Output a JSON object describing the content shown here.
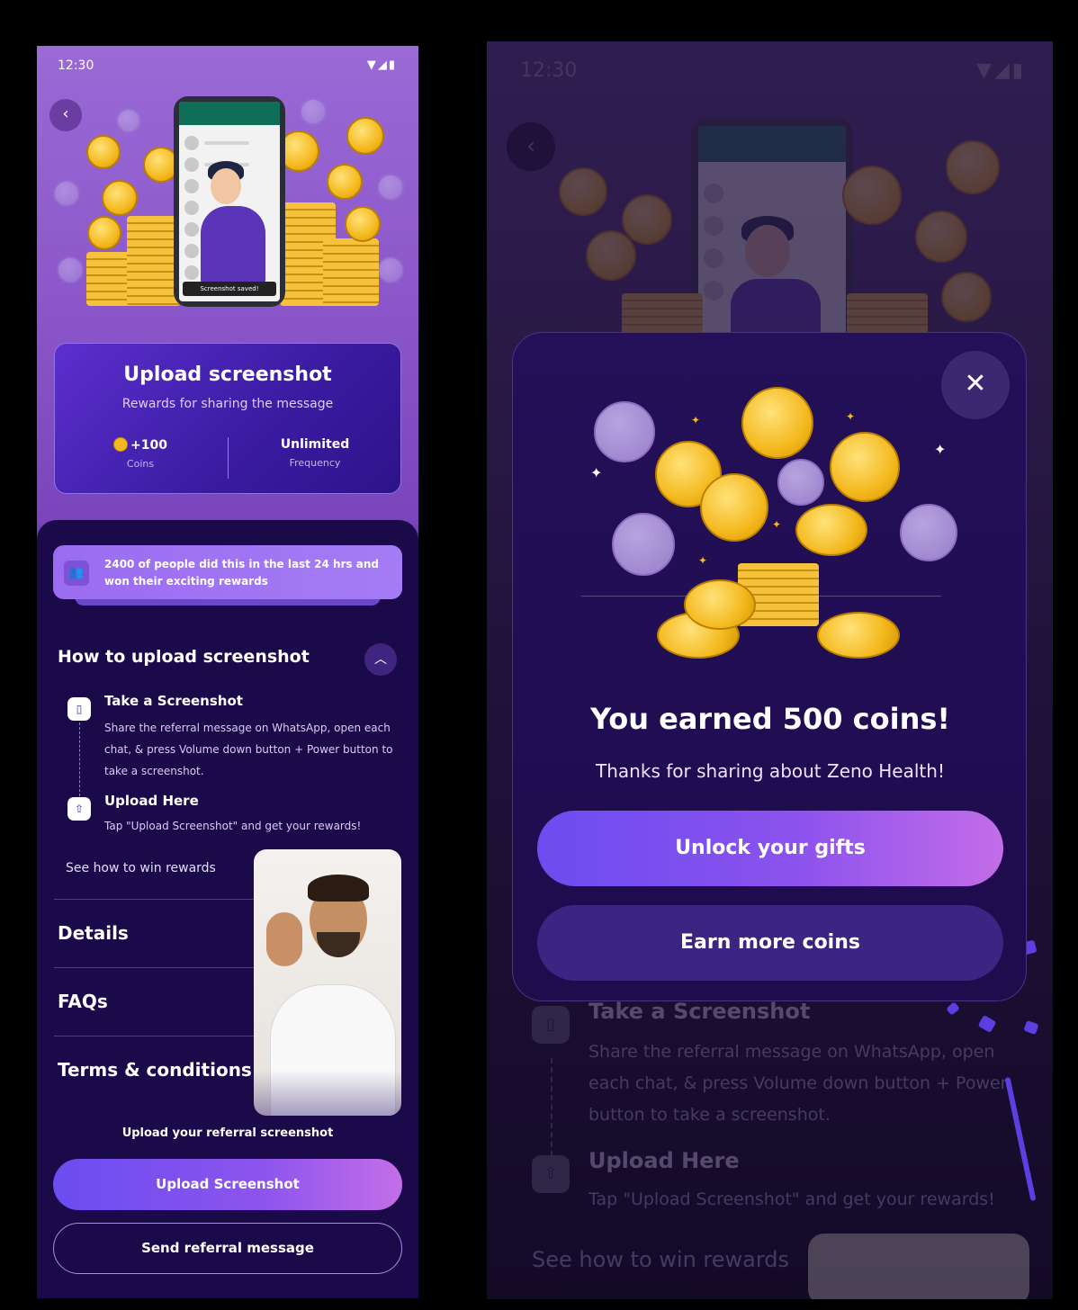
{
  "left": {
    "status": {
      "time": "12:30",
      "icons": "▼◢▮"
    },
    "illustration": {
      "toast": "Screenshot saved!"
    },
    "task": {
      "title": "Upload screenshot",
      "subtitle": "Rewards for sharing the message",
      "coins_value": "+100",
      "coins_label": "Coins",
      "frequency_value": "Unlimited",
      "frequency_label": "Frequency"
    },
    "banner": {
      "text": "2400 of people did this in the last 24 hrs and won their exciting rewards"
    },
    "how": {
      "title": "How to upload screenshot",
      "steps": [
        {
          "title": "Take a Screenshot",
          "desc": "Share the referral message on WhatsApp, open each chat, & press Volume down button + Power button to take a screenshot."
        },
        {
          "title": "Upload Here",
          "desc": "Tap \"Upload Screenshot\" and get your rewards!"
        }
      ]
    },
    "see_how": "See how to win rewards",
    "sections": [
      "Details",
      "FAQs",
      "Terms & conditions"
    ],
    "upload_caption": "Upload your referral screenshot",
    "primary_button": "Upload Screenshot",
    "secondary_button": "Send referral message"
  },
  "right": {
    "status": {
      "time": "12:30",
      "icons": "▼◢▮"
    },
    "modal": {
      "close": "✕",
      "title": "You earned 500 coins!",
      "subtitle": "Thanks for sharing about Zeno Health!",
      "primary_button": "Unlock your gifts",
      "secondary_button": "Earn more coins"
    },
    "background": {
      "step1_title": "Take a Screenshot",
      "step1_desc": "Share the referral message on WhatsApp, open each chat, & press Volume down button + Power button to take a screenshot.",
      "step2_title": "Upload Here",
      "step2_desc": "Tap \"Upload Screenshot\" and get your rewards!",
      "see_how": "See how to win rewards"
    }
  },
  "colors": {
    "accent": "#7b4ff0",
    "sheet": "#1b0a4a",
    "coin": "#f4b91e"
  }
}
